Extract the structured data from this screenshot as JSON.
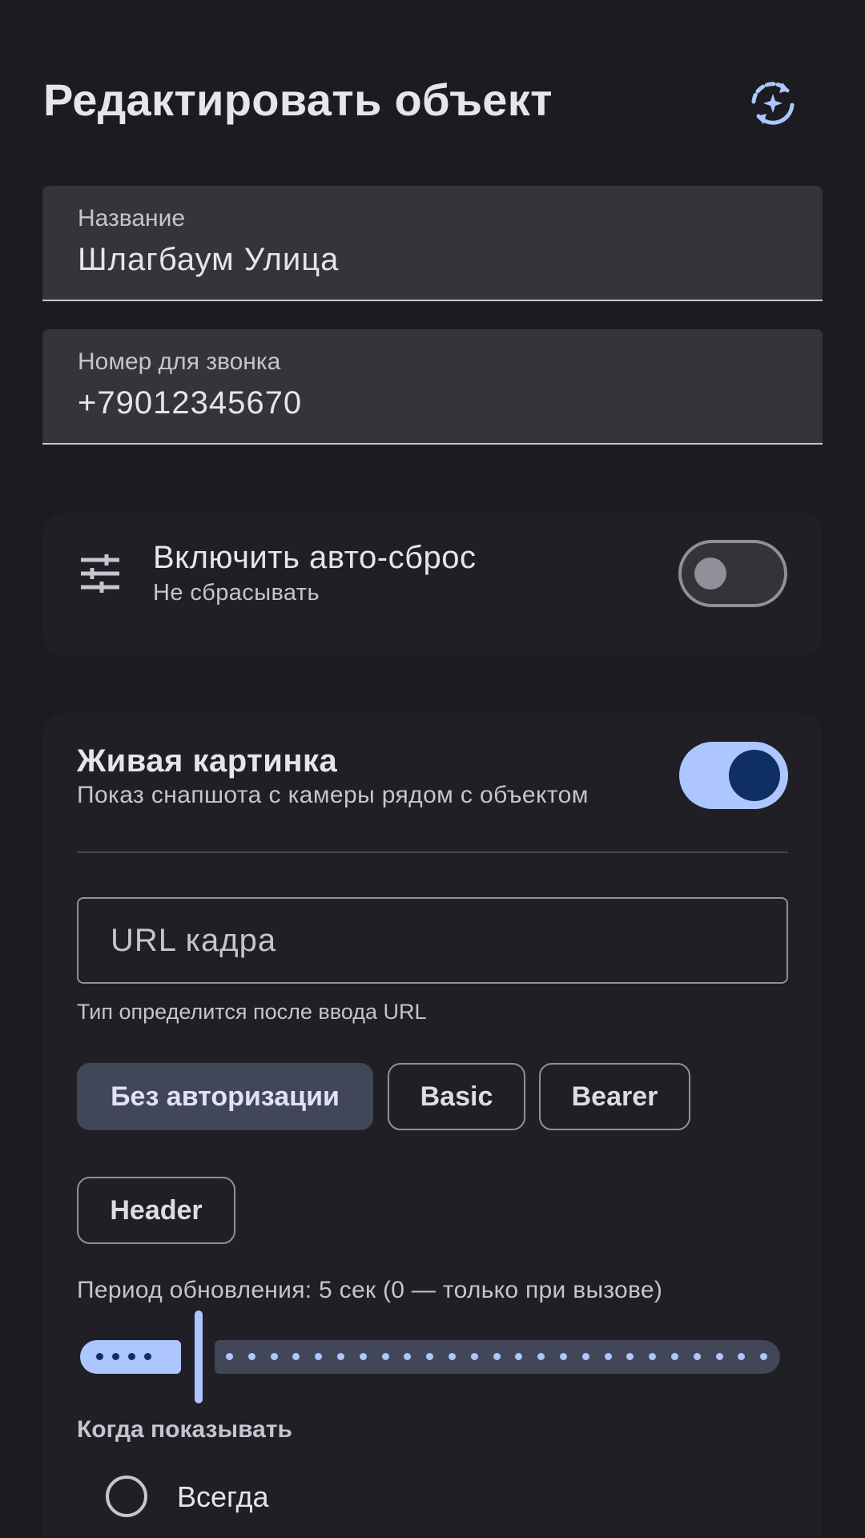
{
  "header": {
    "title": "Редактировать объект",
    "action_icon": "sync-sparkle-icon"
  },
  "fields": {
    "name": {
      "label": "Название",
      "value": "Шлагбаум Улица"
    },
    "phone": {
      "label": "Номер для звонка",
      "value": "+79012345670"
    }
  },
  "auto_reset": {
    "icon": "tune-icon",
    "title": "Включить авто-сброс",
    "subtitle": "Не сбрасывать",
    "enabled": false
  },
  "live_picture": {
    "title": "Живая картинка",
    "subtitle": "Показ снапшота с камеры рядом с объектом",
    "enabled": true,
    "url_placeholder": "URL кадра",
    "url_value": "",
    "helper": "Тип определится после ввода URL",
    "auth_options": [
      "Без авторизации",
      "Basic",
      "Bearer",
      "Header"
    ],
    "auth_selected": "Без авторизации",
    "period_label": "Период обновления: 5 сек (0 — только при вызове)",
    "period_value": 5,
    "when_label": "Когда показывать",
    "when_options": [
      "Всегда"
    ]
  },
  "colors": {
    "background": "#1b1b20",
    "primary": "#aec6ff",
    "on_primary": "#0f2e61",
    "surface_container": "#34353b",
    "chip_selected": "#414659"
  }
}
